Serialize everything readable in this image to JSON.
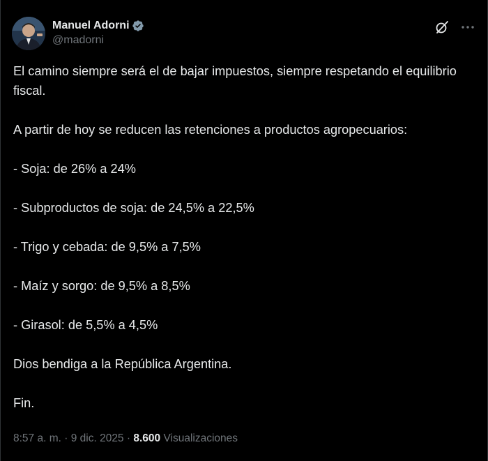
{
  "author": {
    "display_name": "Manuel Adorni",
    "handle": "@madorni",
    "verified_icon": "verified-badge-icon",
    "avatar_icon": "avatar"
  },
  "header_actions": {
    "grok_icon": "grok-icon",
    "more_icon": "more-options-icon"
  },
  "tweet": {
    "paragraphs": [
      "El camino siempre será el de bajar impuestos, siempre respetando el equilibrio fiscal.",
      "A partir de hoy se reducen las retenciones a productos agropecuarios:",
      "- Soja: de 26% a 24%",
      "- Subproductos de soja: de 24,5% a 22,5%",
      "- Trigo y cebada: de 9,5% a 7,5%",
      "- Maíz y sorgo: de 9,5% a 8,5%",
      "- Girasol: de 5,5% a 4,5%",
      "Dios bendiga a la República Argentina.",
      "Fin."
    ]
  },
  "meta": {
    "time": "8:57 a. m.",
    "separator": " · ",
    "date": "9 dic. 2025",
    "views_count": "8.600",
    "views_label": "Visualizaciones"
  },
  "colors": {
    "background": "#000000",
    "text_primary": "#e7e9ea",
    "text_secondary": "#71767b",
    "verified": "#829aab"
  }
}
